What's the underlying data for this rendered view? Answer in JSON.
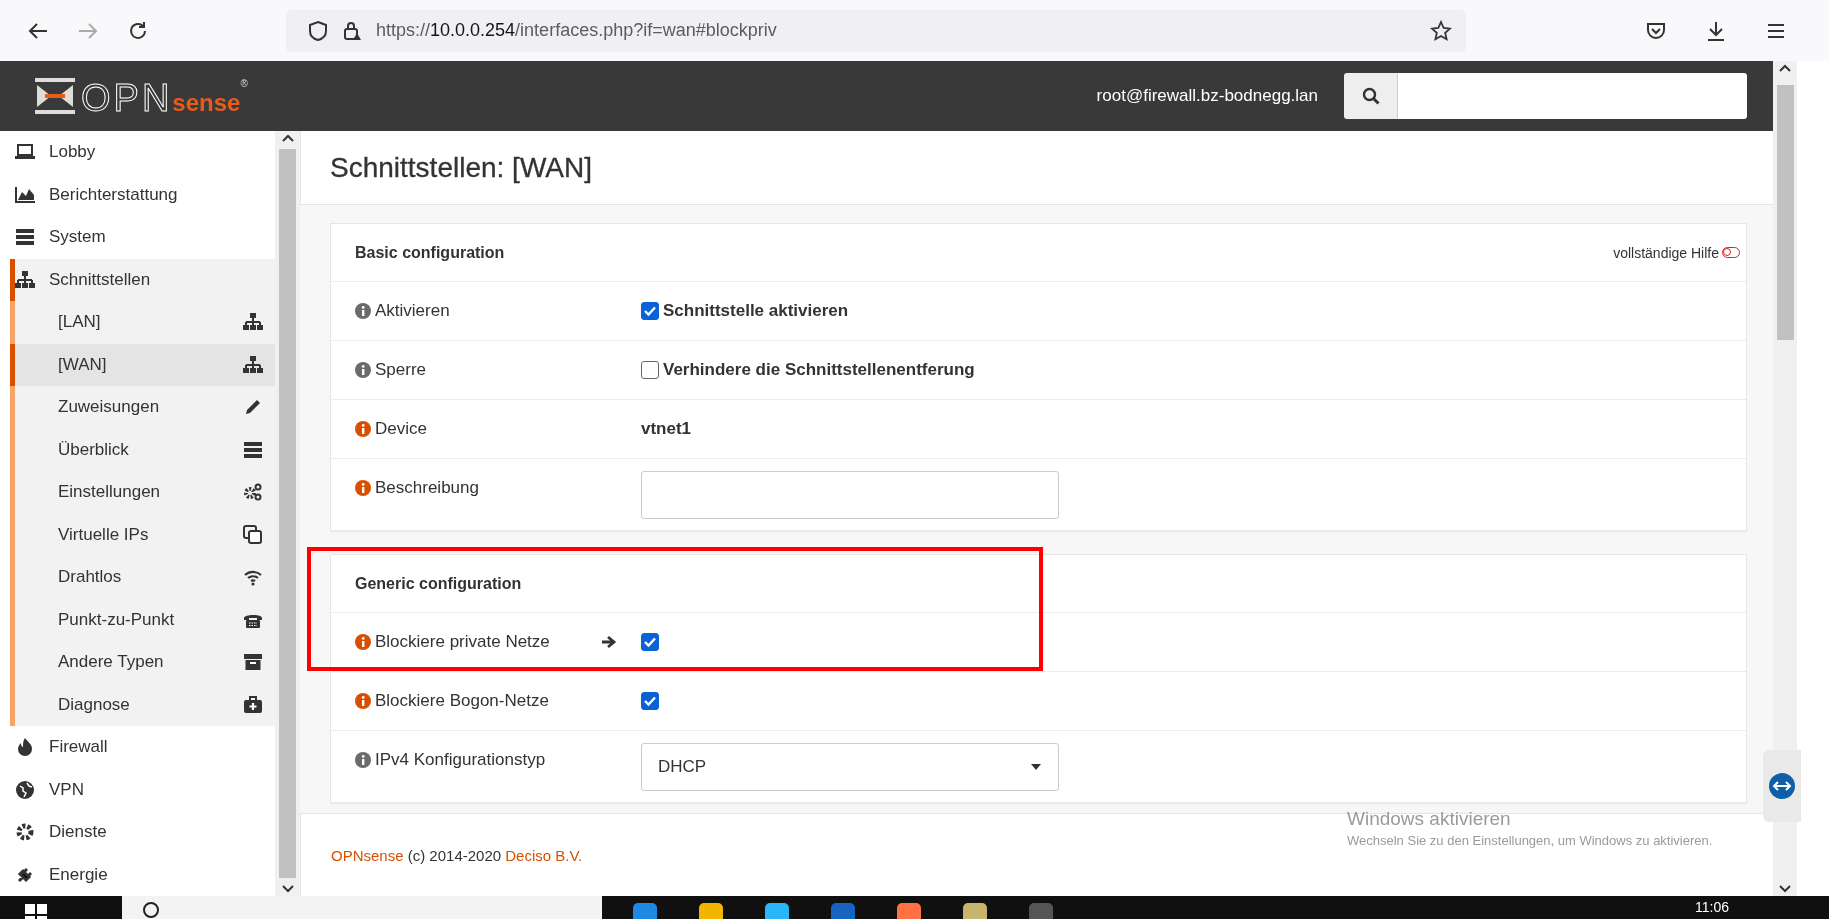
{
  "browser": {
    "url_scheme": "https://",
    "url_host": "10.0.0.254",
    "url_path": "/interfaces.php?if=wan#blockpriv"
  },
  "header": {
    "logo": {
      "brand": "OPN",
      "suffix": "sense",
      "mark": "®"
    },
    "user": "root@firewall.bz-bodnegg.lan"
  },
  "sidebar": {
    "items": [
      {
        "label": "Lobby",
        "selected": false
      },
      {
        "label": "Berichterstattung",
        "selected": false
      },
      {
        "label": "System",
        "selected": false
      },
      {
        "label": "Schnittstellen",
        "selected": false,
        "expanded": true,
        "children": [
          {
            "label": "[LAN]",
            "selected": false
          },
          {
            "label": "[WAN]",
            "selected": true
          },
          {
            "label": "Zuweisungen",
            "selected": false
          },
          {
            "label": "Überblick",
            "selected": false
          },
          {
            "label": "Einstellungen",
            "selected": false
          },
          {
            "label": "Virtuelle IPs",
            "selected": false
          },
          {
            "label": "Drahtlos",
            "selected": false
          },
          {
            "label": "Punkt-zu-Punkt",
            "selected": false
          },
          {
            "label": "Andere Typen",
            "selected": false
          },
          {
            "label": "Diagnose",
            "selected": false
          }
        ]
      },
      {
        "label": "Firewall",
        "selected": false
      },
      {
        "label": "VPN",
        "selected": false
      },
      {
        "label": "Dienste",
        "selected": false
      },
      {
        "label": "Energie",
        "selected": false
      }
    ]
  },
  "content": {
    "title": "Schnittstellen: [WAN]",
    "sections": [
      {
        "title": "Basic configuration",
        "help_label": "vollständige Hilfe",
        "help_on": false,
        "rows": [
          {
            "kind": "checkbox",
            "label": "Aktivieren",
            "color": "#6b6b6b",
            "checked": true,
            "text": "Schnittstelle aktivieren"
          },
          {
            "kind": "checkbox",
            "label": "Sperre",
            "color": "#6b6b6b",
            "checked": false,
            "text": "Verhindere die Schnittstellenentferung"
          },
          {
            "kind": "static",
            "label": "Device",
            "color": "#d94f00",
            "value": "vtnet1"
          },
          {
            "kind": "input",
            "label": "Beschreibung",
            "color": "#d94f00"
          }
        ]
      },
      {
        "title": "Generic configuration",
        "rows": [
          {
            "kind": "checkbox",
            "label": "Blockiere private Netze",
            "color": "#d94f00",
            "checked": true,
            "highlighted": true,
            "arrow": true
          },
          {
            "kind": "checkbox",
            "label": "Blockiere Bogon-Netze",
            "color": "#d94f00",
            "checked": true
          },
          {
            "kind": "select",
            "label": "IPv4 Konfigurationstyp",
            "color": "#6b6b6b",
            "value": "DHCP"
          }
        ]
      }
    ]
  },
  "footer": {
    "parts": [
      {
        "kind": "link",
        "text": "OPNsense"
      },
      {
        "kind": "text",
        "text": "(c) 2014-2020"
      },
      {
        "kind": "link",
        "text": "Deciso B.V."
      }
    ]
  },
  "os": {
    "activation": {
      "title": "Windows aktivieren",
      "text": "Wechseln Sie zu den Einstellungen, um Windows zu aktivieren."
    },
    "taskbar": {
      "clock": "11:06"
    }
  }
}
